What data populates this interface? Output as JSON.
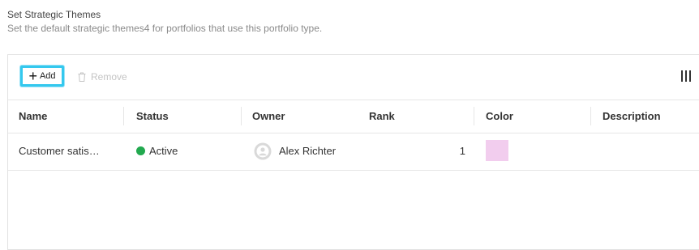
{
  "header": {
    "title": "Set Strategic Themes",
    "description": "Set the default strategic themes4 for portfolios that use this portfolio type."
  },
  "toolbar": {
    "add_label": "Add",
    "remove_label": "Remove"
  },
  "table": {
    "columns": [
      "Name",
      "Status",
      "Owner",
      "Rank",
      "Color",
      "Description"
    ],
    "rows": [
      {
        "name": "Customer satis…",
        "status": "Active",
        "status_color": "#22a94f",
        "owner": "Alex Richter",
        "rank": "1",
        "color": "#f2cdee",
        "description": ""
      }
    ]
  },
  "colors": {
    "accent_outline": "#34c8ee",
    "border": "#e6e6e6"
  }
}
